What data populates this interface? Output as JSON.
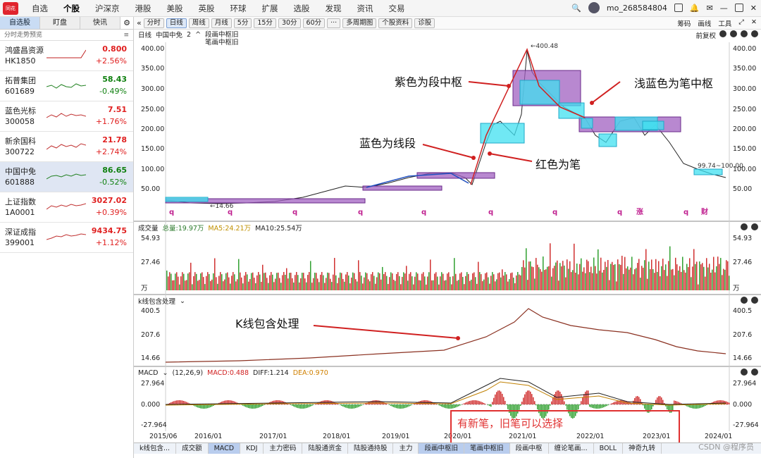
{
  "nav": [
    "自选",
    "个股",
    "沪深京",
    "港股",
    "美股",
    "英股",
    "环球",
    "扩展",
    "选股",
    "发现",
    "资讯",
    "交易"
  ],
  "user": {
    "name": "mo_268584804"
  },
  "toolbar": {
    "items": [
      "分时",
      "日线",
      "周线",
      "月线",
      "5分",
      "15分",
      "30分",
      "60分",
      "···",
      "多周期图",
      "个股资料",
      "诊股"
    ],
    "right": [
      "筹码",
      "画线",
      "工具"
    ]
  },
  "left": {
    "tabs": [
      "自选股",
      "盯盘",
      "快讯"
    ],
    "header": "分时走势预览",
    "stocks": [
      {
        "name": "鸿盛昌资源",
        "code": "HK1850",
        "price": "0.800",
        "chg": "+2.56%",
        "dir": "up"
      },
      {
        "name": "拓普集团",
        "code": "601689",
        "price": "58.43",
        "chg": "-0.49%",
        "dir": "down"
      },
      {
        "name": "蓝色光标",
        "code": "300058",
        "price": "7.51",
        "chg": "+1.76%",
        "dir": "up"
      },
      {
        "name": "新余国科",
        "code": "300722",
        "price": "21.78",
        "chg": "+2.74%",
        "dir": "up"
      },
      {
        "name": "中国中免",
        "code": "601888",
        "price": "86.65",
        "chg": "-0.52%",
        "dir": "down"
      },
      {
        "name": "上证指数",
        "code": "1A0001",
        "price": "3027.02",
        "chg": "+0.39%",
        "dir": "up"
      },
      {
        "name": "深证成指",
        "code": "399001",
        "price": "9434.75",
        "chg": "+1.12%",
        "dir": "up"
      }
    ]
  },
  "main": {
    "header": {
      "period": "日线",
      "name": "中国中免",
      "num": "2",
      "labels": [
        "段画中枢旧",
        "笔画中枢旧"
      ],
      "right": "前复权"
    },
    "yticks": [
      "400.00",
      "350.00",
      "300.00",
      "250.00",
      "200.00",
      "150.00",
      "100.00",
      "50.00"
    ],
    "high_label": "←400.48",
    "low_label": "←14.66",
    "last_label": "99.74~100.00",
    "markers": [
      "q",
      "q",
      "q",
      "q",
      "q",
      "q",
      "q",
      "q",
      "涨",
      "q",
      "财"
    ]
  },
  "volume": {
    "title": "成交量",
    "total": "总量:19.97万",
    "ma5": "MA5:24.21万",
    "ma10": "MA10:25.54万",
    "yticks": [
      "54.93",
      "27.46",
      "万"
    ]
  },
  "kline": {
    "title": "k线包含处理",
    "yticks": [
      "400.5",
      "207.6",
      "14.66"
    ]
  },
  "macd": {
    "title": "MACD",
    "params": "(12,26,9)",
    "macd": "MACD:0.488",
    "diff": "DIFF:1.214",
    "dea": "DEA:0.970",
    "yticks": [
      "27.964",
      "0.000",
      "-27.964"
    ],
    "xlabels": [
      "2015/06",
      "2016/01",
      "2017/01",
      "2018/01",
      "2019/01",
      "2020/01",
      "2021/01",
      "2022/01",
      "2023/01",
      "2024/01"
    ]
  },
  "annotations": {
    "purple": "紫色为段中枢",
    "cyan": "浅蓝色为笔中枢",
    "blue": "蓝色为线段",
    "red": "红色为笔",
    "kline": "K线包含处理",
    "newpen": "有新笔，旧笔可以选择"
  },
  "bottomtabs": [
    "k线包含...",
    "成交额",
    "MACD",
    "KDJ",
    "主力密码",
    "陆股通资金",
    "陆股通持股",
    "主力",
    "段画中枢旧",
    "笔画中枢旧",
    "段画中枢",
    "缠论笔画...",
    "BOLL",
    "神奇九转"
  ],
  "watermark": "CSDN @程序员"
}
